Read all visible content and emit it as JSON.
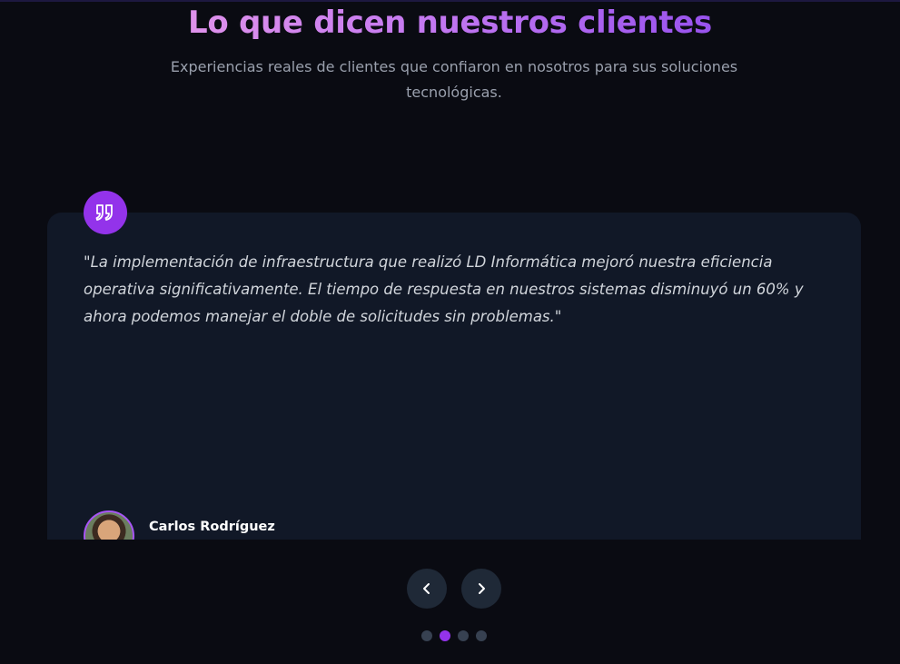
{
  "section": {
    "title": "Lo que dicen nuestros clientes",
    "subtitle": "Experiencias reales de clientes que confiaron en nosotros para sus soluciones tecnológicas."
  },
  "testimonial": {
    "quote_icon": "quote-icon",
    "text": "\"La implementación de infraestructura que realizó LD Informática mejoró nuestra eficiencia operativa significativamente. El tiempo de respuesta en nuestros sistemas disminuyó un 60% y ahora podemos manejar el doble de solicitudes sin problemas.\"",
    "author": {
      "name": "Carlos Rodríguez",
      "avatar_icon": "avatar-photo"
    }
  },
  "carousel": {
    "prev_icon": "chevron-left-icon",
    "next_icon": "chevron-right-icon",
    "active_index": 1,
    "dot_count": 4
  },
  "colors": {
    "background": "#0a0b12",
    "card": "#111827",
    "accent": "#9333ea",
    "button": "#1f2937"
  }
}
